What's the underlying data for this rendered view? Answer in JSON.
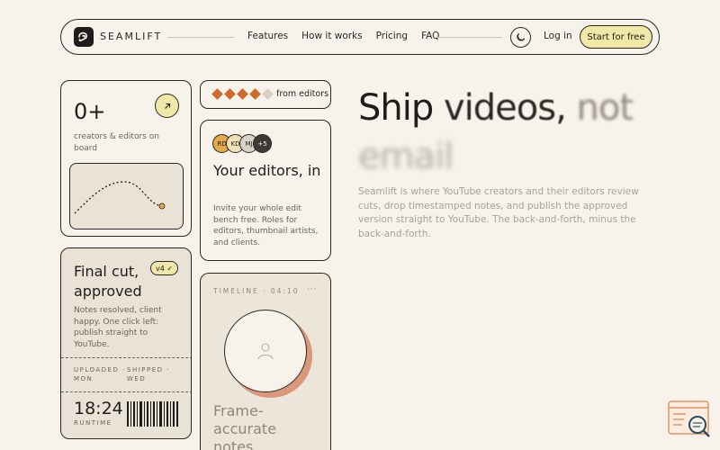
{
  "nav": {
    "brand": "SEAMLIFT",
    "links": [
      "Features",
      "How it works",
      "Pricing",
      "FAQ"
    ],
    "login": "Log in",
    "cta": "Start for free",
    "icons": {
      "brand": "seamlift-logo-icon",
      "theme": "moon-icon"
    }
  },
  "stats_card": {
    "number": "0+",
    "label": "creators & editors on board",
    "icon": "arrow-up-right-icon"
  },
  "final_card": {
    "title": "Final cut, approved",
    "badge": "v4 ✓",
    "desc": "Notes resolved, client happy. One click left: publish straight to YouTube.",
    "uploaded_label": "UPLOADED ·",
    "uploaded_day": "MON",
    "shipped_label": "SHIPPED ·",
    "shipped_day": "WED",
    "runtime": "18:24",
    "runtime_label": "RUNTIME"
  },
  "rating_card": {
    "text": "from editors",
    "filled": 4,
    "total": 5,
    "colors": {
      "filled": "#d2692a",
      "empty": "#d6d0c6"
    }
  },
  "editors_card": {
    "avatars": [
      {
        "initials": "RD",
        "color": "#e3a94a"
      },
      {
        "initials": "KD",
        "color": "#efe3b6"
      },
      {
        "initials": "MJ",
        "color": "#d8d2c8"
      },
      {
        "initials": "+5",
        "color": "#3d3a36"
      }
    ],
    "title": "Your editors, in",
    "desc": "Invite your whole edit bench free. Roles for editors, thumbnail artists, and clients."
  },
  "timeline_card": {
    "label": "TIMELINE · 04:10",
    "more": "···",
    "title": "Frame-accurate notes",
    "icon": "user-icon"
  },
  "hero": {
    "w1": "Ship",
    "w2": "videos,",
    "w3": "not",
    "w4": "email",
    "paragraph": "Seamlift is where YouTube creators and their editors review cuts, drop timestamped notes, and publish the approved version straight to YouTube. The back-and-forth, minus the back-and-forth."
  },
  "colors": {
    "background": "#f7f3eb",
    "accent_yellow": "#f1e8a8",
    "accent_orange": "#d2692a",
    "ink": "#1f1d1a"
  },
  "widget": {
    "icon": "search-window-icon"
  }
}
